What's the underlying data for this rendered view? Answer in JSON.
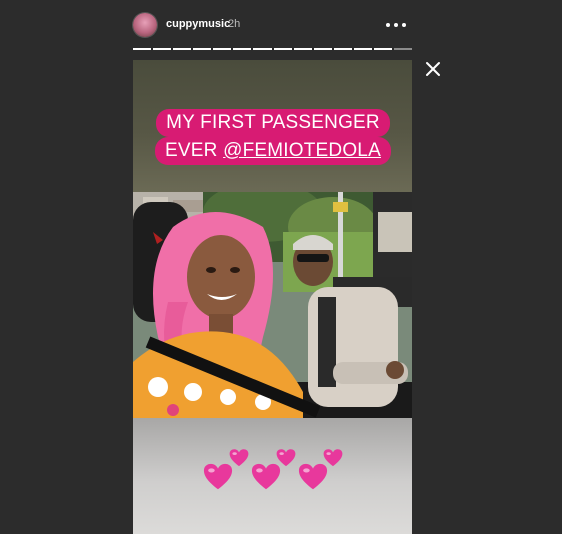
{
  "header": {
    "username": "cuppymusic",
    "timestamp": "2h",
    "more_icon": "more-horizontal-icon"
  },
  "progress": {
    "segments_total": 14,
    "segments_viewed": 13
  },
  "close_icon": "close-icon",
  "story": {
    "caption_line1": "MY FIRST PASSENGER",
    "caption_line2_prefix": "EVER ",
    "caption_mention": "@FEMIOTEDOLA",
    "caption_color": "#d81b73",
    "sticker_icons": [
      "heart-icon",
      "heart-icon",
      "heart-icon",
      "heart-icon",
      "heart-icon",
      "heart-icon"
    ],
    "heart_color": "#e8389c"
  }
}
